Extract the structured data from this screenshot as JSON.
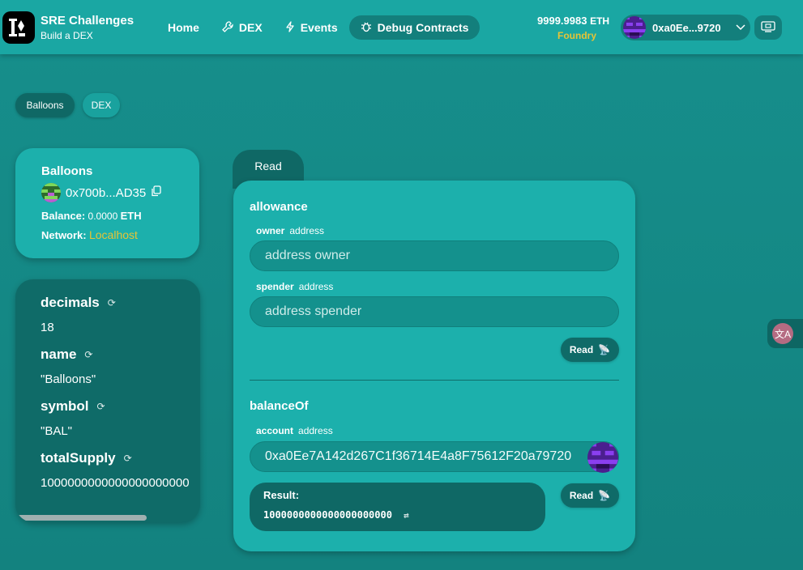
{
  "header": {
    "brand_title": "SRE Challenges",
    "brand_subtitle": "Build a DEX",
    "nav": [
      {
        "label": "Home",
        "icon": ""
      },
      {
        "label": "DEX",
        "icon": "wrench-icon"
      },
      {
        "label": "Events",
        "icon": "lightning-icon"
      },
      {
        "label": "Debug Contracts",
        "icon": "bug-icon",
        "active": true
      }
    ],
    "eth_amount": "9999.9983",
    "eth_unit": "ETH",
    "network": "Foundry",
    "account_short": "0xa0Ee...9720",
    "qr_icon": "qr-code-icon"
  },
  "contract_tabs": [
    {
      "label": "Balloons",
      "active": true
    },
    {
      "label": "DEX",
      "active": false
    }
  ],
  "contract": {
    "name": "Balloons",
    "address_short": "0x700b...AD35",
    "balance_label": "Balance:",
    "balance_value": "0.0000",
    "balance_unit": "ETH",
    "network_label": "Network:",
    "network_value": "Localhost"
  },
  "variables": [
    {
      "name": "decimals",
      "value": "18"
    },
    {
      "name": "name",
      "value": "\"Balloons\""
    },
    {
      "name": "symbol",
      "value": "\"BAL\""
    },
    {
      "name": "totalSupply",
      "value": "1000000000000000000000"
    }
  ],
  "read_tab": "Read",
  "functions": {
    "allowance": {
      "title": "allowance",
      "params": [
        {
          "name": "owner",
          "type": "address",
          "placeholder": "address owner"
        },
        {
          "name": "spender",
          "type": "address",
          "placeholder": "address spender"
        }
      ],
      "button": "Read"
    },
    "balanceOf": {
      "title": "balanceOf",
      "param": {
        "name": "account",
        "type": "address",
        "value": "0xa0Ee7A142d267C1f36714E4a8F75612F20a79720"
      },
      "button": "Read",
      "result_label": "Result:",
      "result_value": "1000000000000000000000"
    }
  },
  "colors": {
    "background": "#168f8c",
    "header": "#1aa7a3",
    "card": "#1cb0ac",
    "dark": "#0f6865",
    "accent_yellow": "#e6c436"
  }
}
